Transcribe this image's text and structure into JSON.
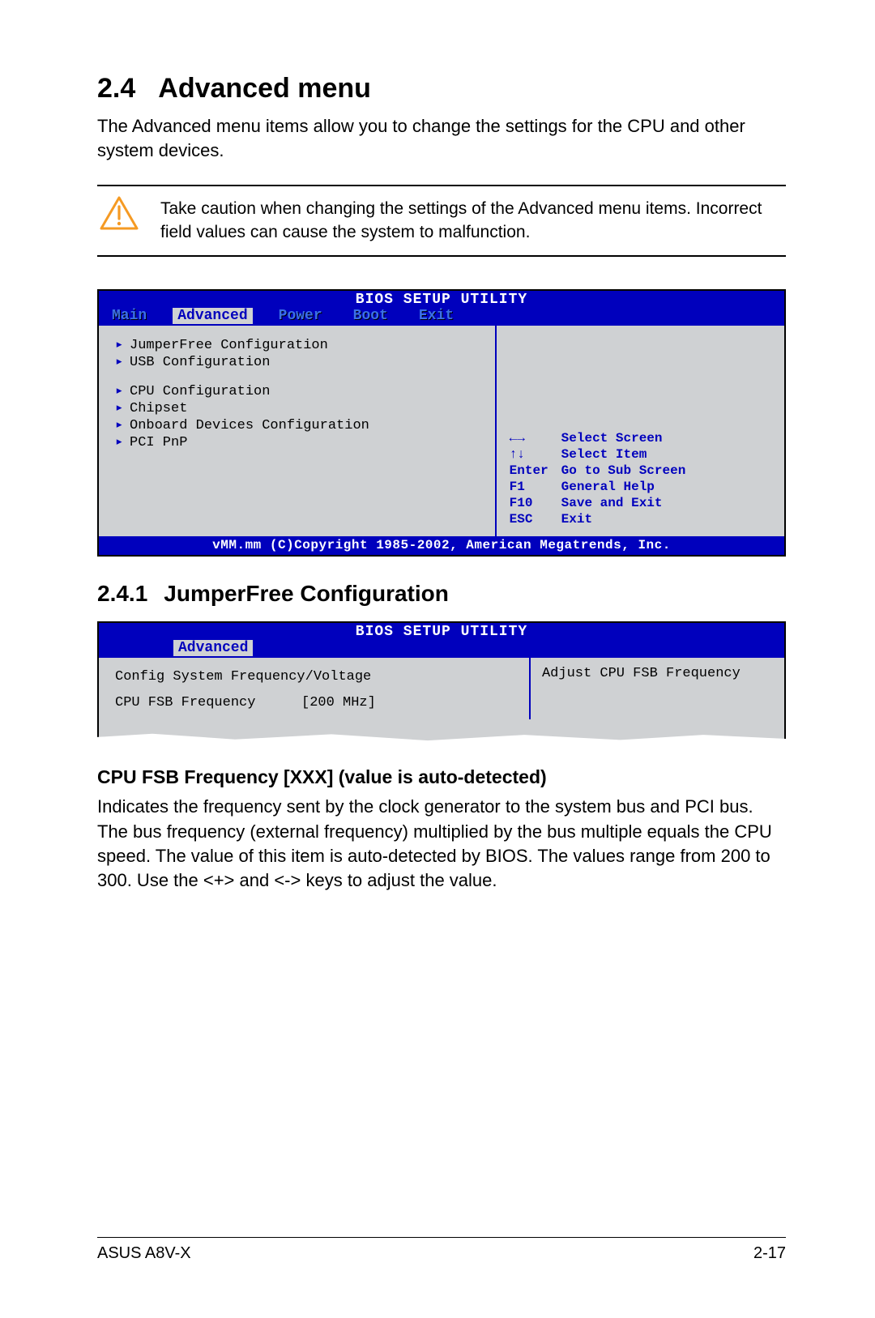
{
  "section": {
    "number": "2.4",
    "title": "Advanced menu"
  },
  "intro": "The Advanced menu items allow you to change the settings for the CPU and other system devices.",
  "caution": "Take caution when changing the settings of the Advanced menu items. Incorrect field values can cause the system to malfunction.",
  "bios1": {
    "utility_title": "BIOS SETUP UTILITY",
    "tabs": [
      "Main",
      "Advanced",
      "Power",
      "Boot",
      "Exit"
    ],
    "active_tab": "Advanced",
    "group1": [
      "JumperFree Configuration",
      "USB Configuration"
    ],
    "group2": [
      "CPU Configuration",
      "Chipset",
      "Onboard Devices Configuration",
      "PCI PnP"
    ],
    "help": [
      {
        "key": "←→",
        "label": "Select Screen"
      },
      {
        "key": "↑↓",
        "label": "Select Item"
      },
      {
        "key": "Enter",
        "label": "Go to Sub Screen"
      },
      {
        "key": "F1",
        "label": "General Help"
      },
      {
        "key": "F10",
        "label": "Save and Exit"
      },
      {
        "key": "ESC",
        "label": "Exit"
      }
    ],
    "copyright": "vMM.mm (C)Copyright 1985-2002, American Megatrends, Inc."
  },
  "subsection": {
    "number": "2.4.1",
    "title": "JumperFree Configuration"
  },
  "bios2": {
    "utility_title": "BIOS SETUP UTILITY",
    "active_tab": "Advanced",
    "heading": "Config System Frequency/Voltage",
    "item_label": "CPU FSB Frequency",
    "item_value": "[200 MHz]",
    "help_text": "Adjust CPU FSB Frequency"
  },
  "option": {
    "heading": "CPU FSB Frequency [XXX] (value is auto-detected)",
    "body": "Indicates the frequency sent by the clock generator to the system bus and PCI bus. The bus frequency (external frequency) multiplied by the bus multiple equals the CPU speed. The value of this item is auto-detected by BIOS. The values range from 200 to 300. Use the <+> and <-> keys to adjust the value."
  },
  "footer": {
    "left": "ASUS A8V-X",
    "right": "2-17"
  }
}
